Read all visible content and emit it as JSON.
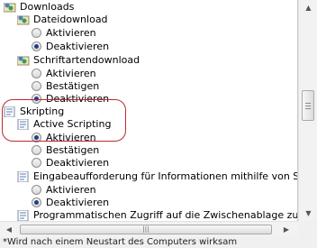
{
  "tree": {
    "downloads": "Downloads",
    "dateidownload": "Dateidownload",
    "dateidownload_aktivieren": "Aktivieren",
    "dateidownload_deaktivieren": "Deaktivieren",
    "schriftartendownload": "Schriftartendownload",
    "schrift_aktivieren": "Aktivieren",
    "schrift_bestaetigen": "Bestätigen",
    "schrift_deaktivieren": "Deaktivieren",
    "skripting": "Skripting",
    "active_scripting": "Active Scripting",
    "as_aktivieren": "Aktivieren",
    "as_bestaetigen": "Bestätigen",
    "as_deaktivieren": "Deaktivieren",
    "eingabe": "Eingabeaufforderung für Informationen mithilfe von Skriptfen",
    "eingabe_aktivieren": "Aktivieren",
    "eingabe_deaktivieren": "Deaktivieren",
    "programmatisch": "Programmatischen Zugriff auf die Zwischenablage zulassen"
  },
  "footer": {
    "note": "*Wird nach einem Neustart des Computers wirksam"
  },
  "colors": {
    "highlight": "#c0272d",
    "radio_selected": "#1d3f8a"
  }
}
